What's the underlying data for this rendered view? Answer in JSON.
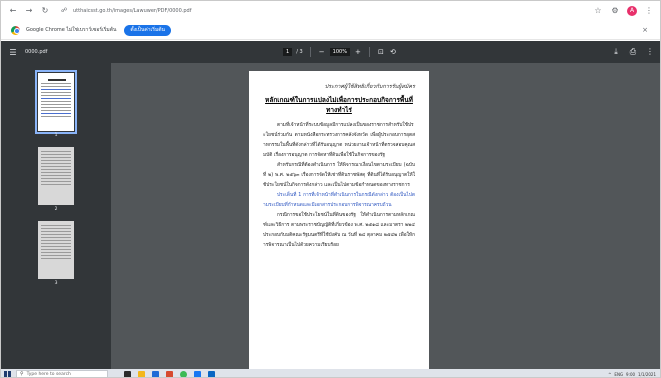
{
  "browser": {
    "url": "utthaicsst.go.th/images/Lawuwer/PDF/0000.pdf",
    "nav_icons": [
      "back-arrow-icon",
      "forward-arrow-icon",
      "reload-icon"
    ],
    "right_icons": [
      "star-icon",
      "extensions-icon",
      "profile-icon",
      "kebab-menu-icon"
    ],
    "profile_initial": "A"
  },
  "infobar": {
    "text": "Google Chrome ไม่ใช่เบราว์เซอร์เริ่มต้น",
    "button_label": "ตั้งเป็นค่าเริ่มต้น",
    "close_glyph": "×"
  },
  "pdf_toolbar": {
    "file_name": "0000.pdf",
    "page_current": "1",
    "page_total": "/ 3",
    "zoom_out_glyph": "−",
    "zoom_value": "100%",
    "zoom_in_glyph": "+",
    "fit_glyph": "⊡",
    "rotate_glyph": "⟲",
    "download_glyph": "⤓",
    "print_glyph": "⎙"
  },
  "thumbnails": [
    {
      "label": "1"
    },
    {
      "label": "2"
    },
    {
      "label": "3"
    }
  ],
  "document": {
    "header_right": "ประกาศผู้ใช้สิทธิเกี่ยวกับการรับผู้สมัคร",
    "title": "หลักเกณฑ์ในการแปลงไม่เพื่อการประกอบกิจการพื้นที่ทางทำไร่",
    "paragraphs": [
      "ตามที่เจ้าหน้าที่ระบบข้อมูลมีการแปลงเป็นของราชการสำหรับใช้ประโยชน์ร่วมกัน ตามหนังสือกระทรวงการคลังจังหวัด เพื่อผู้ประกอบการอุตสาหกรรมในพื้นที่ดังกล่าวที่ได้รับอนุญาต หน่วยงานเจ้าหน้าที่ตรวจสอบคุณสมบัติ เรื่องการอนุญาต การจัดหาที่ดินเพื่อใช้ในกิจการของรัฐ",
      "สำหรับกรณีที่ต้องดำเนินการ ให้พิจารณาเงื่อนไขตามระเบียบ (ฉบับที่ ๒) พ.ศ. ๒๕๖๓ เรื่องการจัดให้เช่าที่ดินราชพัสดุ ที่ดินที่ได้รับอนุญาตให้ใช้ประโยชน์ในกิจการดังกล่าว และเป็นไปตามข้อกำหนดของทางราชการ",
      "ประเด็นที่ 1 การที่เจ้าหน้าที่ดำเนินการในกรณีดังกล่าว ต้องเป็นไปตามระเบียบที่กำหนดและมีเอกสารประกอบการพิจารณาครบถ้วน",
      "กรณีการขอใช้ประโยชน์ในที่ดินของรัฐ ให้ดำเนินการตามหลักเกณฑ์และวิธีการ ตามพระราชบัญญัติที่เกี่ยวข้อง พ.ศ. ๒๕๑๘ และมาตรา ๒๒๔ ประกอบกับมติคณะรัฐมนตรีที่ใช้บังคับ ณ วันที่ ๒๔ ตุลาคม ๒๕๔๒ เพื่อให้การพิจารณาเป็นไปด้วยความเรียบร้อย"
    ]
  },
  "taskbar": {
    "search_placeholder": "Type here to search",
    "tray_text": "ENG",
    "time": "9:00",
    "date": "1/1/2021"
  }
}
